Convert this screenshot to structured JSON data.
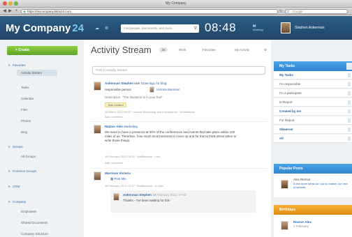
{
  "window": {
    "title": "My Company"
  },
  "browser": {
    "url": "https://mycompany.bitrix24.com",
    "search_placeholder": "Google"
  },
  "header": {
    "brand": "My Company",
    "brand_num": "24",
    "search_placeholder": "Find people, documents, and more",
    "clock": "08:48",
    "clock_sub": "Working",
    "user_name": "Stephen Ankerman"
  },
  "sidebar": {
    "create_label": "Create",
    "sections": [
      {
        "label": "Favorites",
        "items": [
          "Activity Stream",
          "Tasks",
          "Calendar",
          "Files",
          "Photos",
          "Blog"
        ]
      },
      {
        "label": "Groups",
        "items": [
          "All Groups"
        ]
      },
      {
        "label": "Common Groups",
        "items": []
      },
      {
        "label": "CRM",
        "items": []
      },
      {
        "label": "Company",
        "items": [
          "Employees",
          "Shared Documents",
          "Company Structure"
        ]
      }
    ]
  },
  "main": {
    "title": "Activity Stream",
    "counter": "24",
    "tabs": [
      "Work",
      "Favorites",
      "My Activity"
    ],
    "post_placeholder": "Post to Activity Stream",
    "posts": [
      {
        "author": "Ankerman Stephen",
        "action": "task",
        "headline": "Draw logo for blog",
        "line2": "responsible person",
        "responsible": "Victoria Morrison",
        "desc": "Description: \"The limitation is in your feet\"",
        "badge": "Task created",
        "meta": "18 March 2012 09:57 · Unlock Monitoring and Investments · Notifications"
      },
      {
        "author": "Reznor Alex",
        "target": "Marketing",
        "body": "We need to have a presence at 30% of the conferences and events that take place within 100 miles of us. Therefore, how much local business to cover up and for this to think about when to write those things.",
        "meta": "18 February 2012 15:26 · Notifications · Like",
        "comment_action": "Add Comment"
      },
      {
        "author": "Morrison Victoria",
        "body": "Post title",
        "meta": "18 February 2012 15:17 · Notifications · 5 Likes",
        "comment_author": "Ankerman Stephen",
        "comment_meta": "18 February 2012 17:03",
        "comment_body": "Thanks - I've been waiting for this"
      }
    ]
  },
  "right": {
    "tasks_title": "My Tasks",
    "tasks": [
      {
        "label": "My Tasks",
        "bold": true
      },
      {
        "label": "I'm responsible",
        "bold": false
      },
      {
        "label": "I'm a participant",
        "bold": false
      },
      {
        "label": "In Report",
        "bold": false
      },
      {
        "label": "Created by me",
        "bold": true
      },
      {
        "label": "For Report",
        "bold": false
      },
      {
        "label": "Observer",
        "bold": true
      },
      {
        "label": "All",
        "bold": true
      }
    ],
    "popular_title": "Popular Posts",
    "popular_author": "Alex Reznor",
    "popular_text": "A few more ideas on how to market our new proposals",
    "birthdays_title": "Birthdays",
    "birthday_name": "Reznor Alex",
    "birthday_date": "2 February"
  },
  "colors": {
    "header": "#2f5f86",
    "accent_green": "#6cb832",
    "panel_blue": "#3a93dc",
    "panel_orange": "#f0a12a",
    "link": "#2a67a8"
  }
}
